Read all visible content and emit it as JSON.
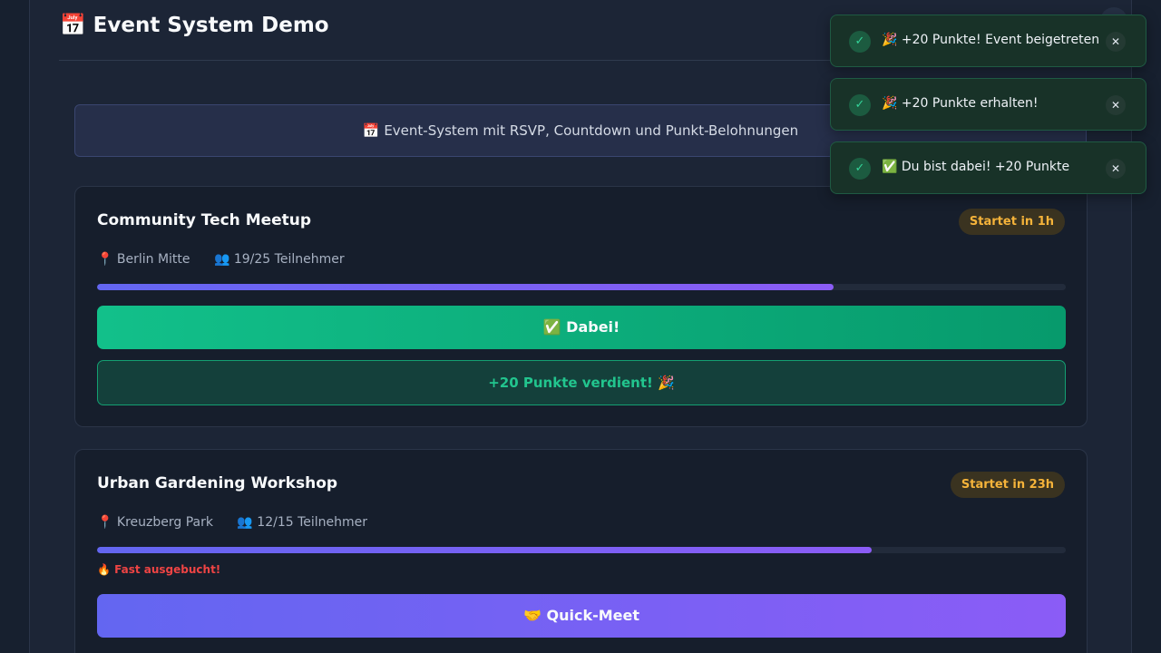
{
  "modal": {
    "title": "📅 Event System Demo",
    "close_icon": "✕"
  },
  "banner": {
    "text": "📅 Event-System mit RSVP, Countdown und Punkt-Belohnungen"
  },
  "events": [
    {
      "title": "Community Tech Meetup",
      "countdown": "Startet in 1h",
      "location": "📍 Berlin Mitte",
      "participants": "👥 19/25 Teilnehmer",
      "fill_fraction": 0.76,
      "rsvp_label": "✅ Dabei!",
      "points_label": "+20 Punkte verdient! 🎉"
    },
    {
      "title": "Urban Gardening Workshop",
      "countdown": "Startet in 23h",
      "location": "📍 Kreuzberg Park",
      "participants": "👥 12/15 Teilnehmer",
      "fill_fraction": 0.8,
      "warning": "🔥 Fast ausgebucht!",
      "quickmeet_label": "🤝 Quick-Meet"
    }
  ],
  "toasts": [
    {
      "icon": "✓",
      "message": "🎉 +20 Punkte! Event beigetreten",
      "close": "✕"
    },
    {
      "icon": "✓",
      "message": "🎉 +20 Punkte erhalten!",
      "close": "✕"
    },
    {
      "icon": "✓",
      "message": "✅ Du bist dabei! +20 Punkte",
      "close": "✕"
    }
  ],
  "colors": {
    "background": "#17202f",
    "accent_green": "#10b981",
    "accent_purple": "#8b5cf6",
    "badge_amber": "#f5b33a",
    "warning_red": "#ef4444"
  }
}
